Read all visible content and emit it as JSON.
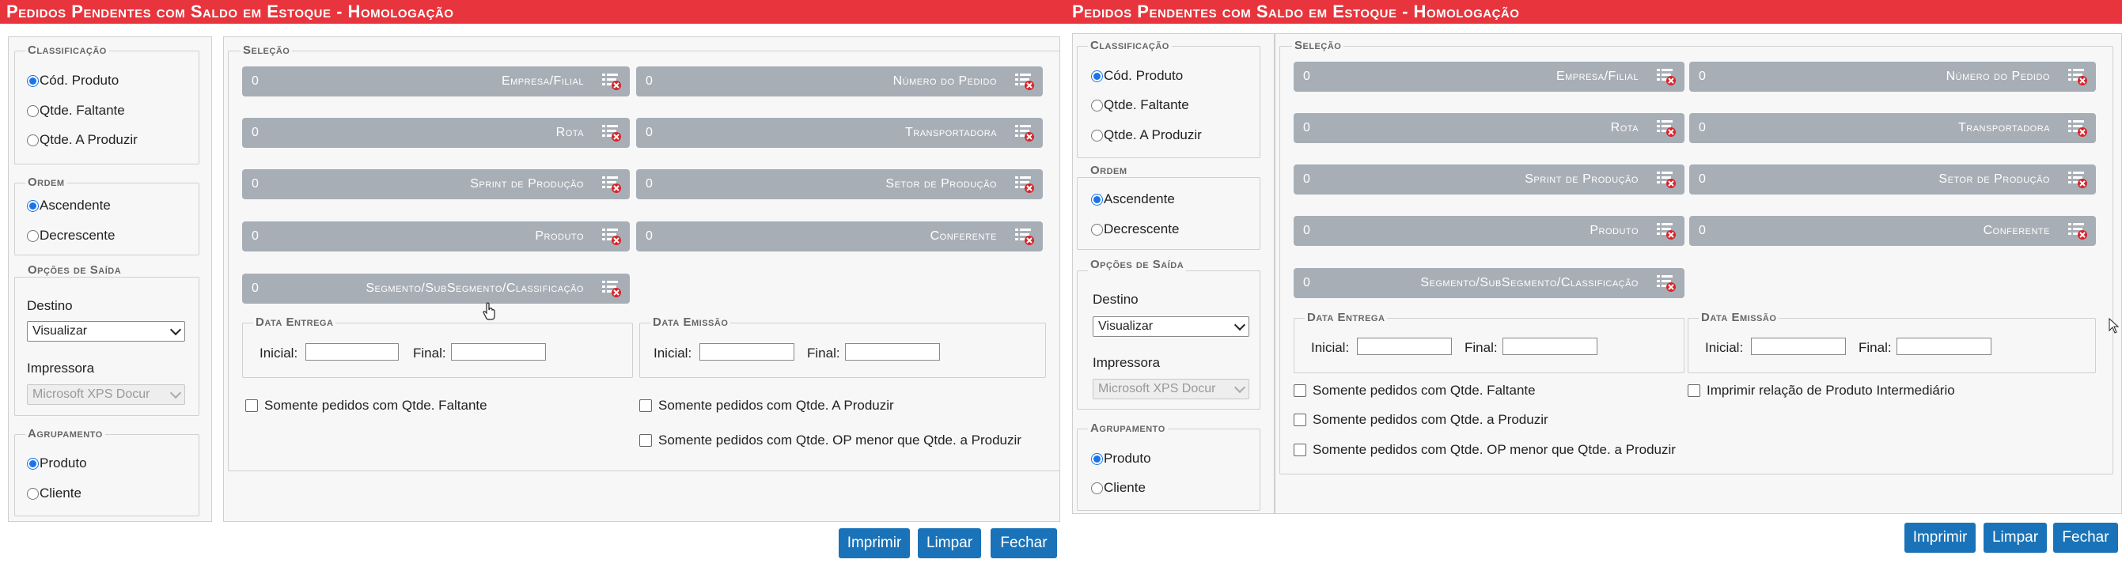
{
  "title": "Pedidos Pendentes com Saldo em Estoque  - Homologação",
  "classificacao": {
    "legend": "Classificação",
    "options": [
      "Cód. Produto",
      "Qtde. Faltante",
      "Qtde. A Produzir"
    ],
    "selected": "Cód. Produto"
  },
  "ordem": {
    "legend": "Ordem",
    "options": [
      "Ascendente",
      "Decrescente"
    ],
    "selected": "Ascendente"
  },
  "saida": {
    "legend": "Opções de Saída",
    "destino_label": "Destino",
    "destino_value": "Visualizar",
    "impressora_label": "Impressora",
    "impressora_value": "Microsoft XPS Docur"
  },
  "agrupamento": {
    "legend": "Agrupamento",
    "options": [
      "Produto",
      "Cliente"
    ],
    "selected": "Produto"
  },
  "selecao": {
    "legend": "Seleção",
    "filters": [
      {
        "value": "0",
        "label": "Empresa/Filial"
      },
      {
        "value": "0",
        "label": "Número do Pedido"
      },
      {
        "value": "0",
        "label": "Rota"
      },
      {
        "value": "0",
        "label": "Transportadora"
      },
      {
        "value": "0",
        "label": "Sprint de Produção"
      },
      {
        "value": "0",
        "label": "Setor de Produção"
      },
      {
        "value": "0",
        "label": "Produto"
      },
      {
        "value": "0",
        "label": "Conferente"
      },
      {
        "value": "0",
        "label": "Segmento/SubSegmento/Classificação"
      }
    ]
  },
  "data_entrega": {
    "legend": "Data Entrega",
    "inicial": "Inicial:",
    "final": "Final:"
  },
  "data_emissao": {
    "legend": "Data Emissão",
    "inicial": "Inicial:",
    "final": "Final:"
  },
  "checks_left": {
    "faltante": "Somente pedidos com Qtde. Faltante",
    "a_produzir": "Somente pedidos com Qtde. A Produzir",
    "op_menor": "Somente pedidos com Qtde. OP menor que Qtde. a Produzir"
  },
  "checks_right": {
    "faltante": "Somente pedidos com Qtde. Faltante",
    "intermediario": "Imprimir relação de Produto Intermediário",
    "a_produzir": "Somente pedidos com Qtde. a Produzir",
    "op_menor": "Somente pedidos com Qtde. OP menor que Qtde. a Produzir"
  },
  "buttons": {
    "imprimir": "Imprimir",
    "limpar": "Limpar",
    "fechar": "Fechar"
  },
  "colors": {
    "title_bar": "#e8343c",
    "filter_bg": "#a7aeb6",
    "button": "#1a73b8"
  }
}
